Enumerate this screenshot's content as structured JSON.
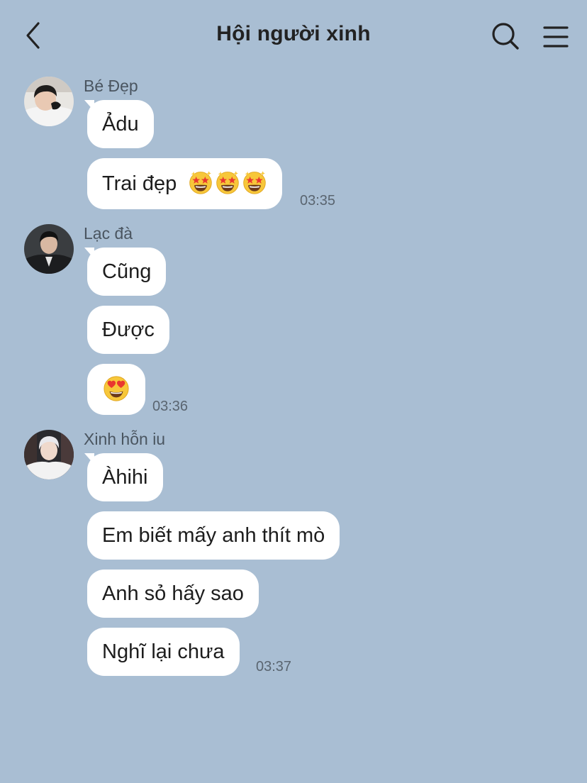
{
  "header": {
    "back_icon": "chevron-left-icon",
    "title": "Hội người xinh",
    "search_icon": "search-icon",
    "menu_icon": "hamburger-menu-icon"
  },
  "groups": [
    {
      "sender": "Bé Đẹp",
      "messages": [
        {
          "text": "Ảdu"
        },
        {
          "text": "Trai đẹp",
          "emoji": "star-struck x3"
        }
      ],
      "time": "03:35"
    },
    {
      "sender": "Lạc đà",
      "messages": [
        {
          "text": "Cũng"
        },
        {
          "text": "Được"
        },
        {
          "text": "",
          "emoji": "heart-eyes"
        }
      ],
      "time": "03:36"
    },
    {
      "sender": "Xinh hỗn iu",
      "messages": [
        {
          "text": "Àhihi"
        },
        {
          "text": "Em biết mấy anh thít mò"
        },
        {
          "text": "Anh sỏ hấy sao"
        },
        {
          "text": "Nghĩ lại chưa"
        }
      ],
      "time": "03:37"
    }
  ],
  "colors": {
    "background": "#a9bed3",
    "bubble": "#ffffff",
    "text": "#1d1d1d"
  }
}
